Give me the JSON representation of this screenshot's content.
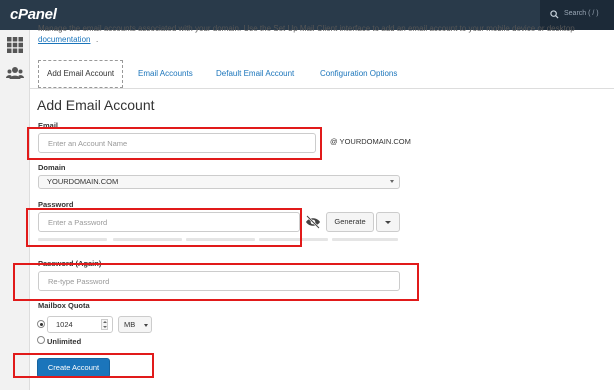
{
  "header": {
    "logo": "cPanel",
    "search_placeholder": "Search ( / )"
  },
  "intro": {
    "text": "Manage the email accounts associated with your domain. Use the Set Up Mail Client interface to add an email account to your mobile device or desktop",
    "link": "documentation",
    "link_suffix": "."
  },
  "tabs": [
    {
      "label": "Add Email Account",
      "active": true
    },
    {
      "label": "Email Accounts"
    },
    {
      "label": "Default Email Account"
    },
    {
      "label": "Configuration Options"
    }
  ],
  "form": {
    "title": "Add Email Account",
    "email_label": "Email",
    "email_placeholder": "Enter an Account Name",
    "at_domain": "@ YOURDOMAIN.COM",
    "domain_label": "Domain",
    "domain_value": "YOURDOMAIN.COM",
    "password_label": "Password",
    "password_placeholder": "Enter a Password",
    "generate_label": "Generate",
    "password_again_label": "Password (Again)",
    "password_again_placeholder": "Re-type Password",
    "quota_label": "Mailbox Quota",
    "quota_value": "1024",
    "quota_unit": "MB",
    "unlimited_label": "Unlimited",
    "create_label": "Create Account"
  },
  "colors": {
    "topbar": "#293a4a",
    "link": "#1b75bb",
    "primary_button": "#1b75bb",
    "highlight": "#e11a1a"
  },
  "icons": [
    "search-icon",
    "grid-icon",
    "users-icon",
    "eye-slash-icon",
    "caret-down-icon",
    "spinner-icon"
  ]
}
